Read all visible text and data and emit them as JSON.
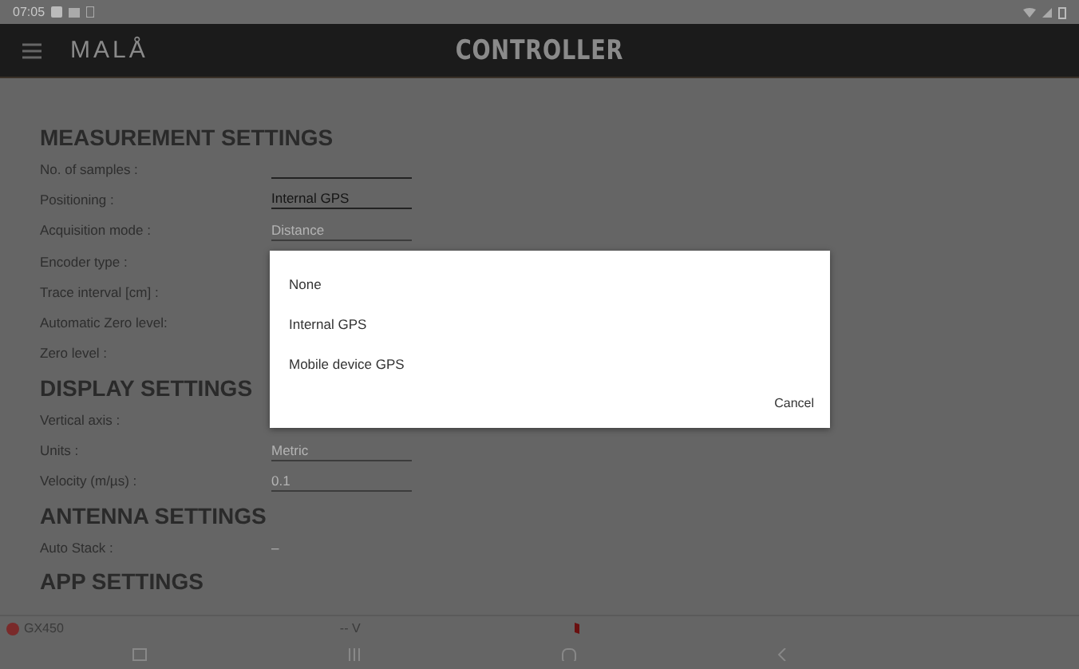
{
  "status_bar": {
    "time": "07:05"
  },
  "app_bar": {
    "logo": "MALÅ",
    "title": "CONTROLLER"
  },
  "sections": [
    {
      "title": "MEASUREMENT SETTINGS",
      "rows": [
        {
          "label": "No. of samples :",
          "kind": "field",
          "disabled": false
        },
        {
          "label": "Positioning :",
          "kind": "field",
          "value": "Internal GPS",
          "disabled": false
        },
        {
          "label": "Acquisition mode :",
          "kind": "field",
          "value": "Distance",
          "disabled": true
        },
        {
          "label": "Encoder type :",
          "kind": "none"
        },
        {
          "label": "Trace interval [cm] :",
          "kind": "none"
        },
        {
          "label": "Automatic Zero level:",
          "kind": "none"
        },
        {
          "label": "Zero level :",
          "kind": "none"
        }
      ]
    },
    {
      "title": "DISPLAY SETTINGS",
      "rows": [
        {
          "label": "Vertical axis :",
          "kind": "none"
        },
        {
          "label": "Units :",
          "kind": "field",
          "value": "Metric",
          "disabled": true
        },
        {
          "label": "Velocity (m/µs) :",
          "kind": "field",
          "value": "0.1",
          "disabled": true
        }
      ]
    },
    {
      "title": "ANTENNA SETTINGS",
      "rows": [
        {
          "label": "Auto Stack :",
          "kind": "text",
          "value": "–"
        }
      ]
    },
    {
      "title": "APP SETTINGS"
    }
  ],
  "dialog": {
    "options": [
      "None",
      "Internal GPS",
      "Mobile device GPS"
    ],
    "button": "Cancel"
  },
  "device_bar": {
    "device": "GX450",
    "voltage": "-- V"
  }
}
